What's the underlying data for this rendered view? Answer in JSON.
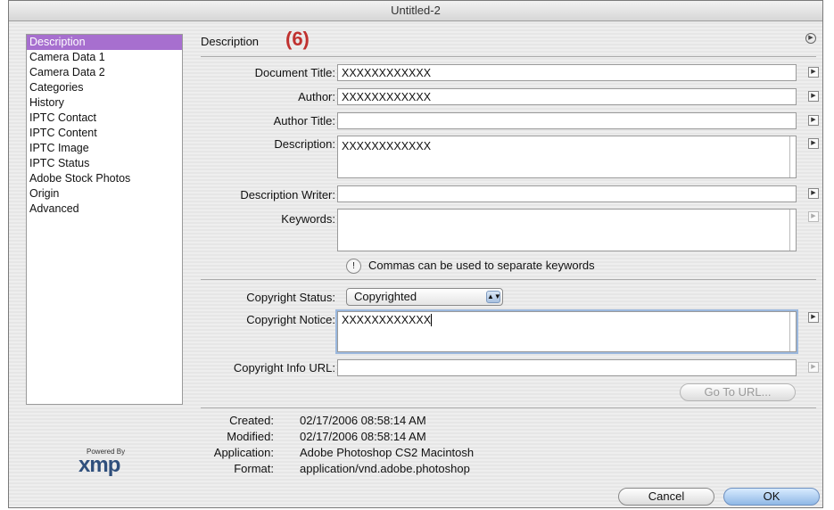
{
  "window": {
    "title": "Untitled-2"
  },
  "annotation": "(6)",
  "sidebar": {
    "items": [
      {
        "label": "Description",
        "selected": true
      },
      {
        "label": "Camera Data 1"
      },
      {
        "label": "Camera Data 2"
      },
      {
        "label": "Categories"
      },
      {
        "label": "History"
      },
      {
        "label": "IPTC Contact"
      },
      {
        "label": "IPTC Content"
      },
      {
        "label": "IPTC Image"
      },
      {
        "label": "IPTC Status"
      },
      {
        "label": "Adobe Stock Photos"
      },
      {
        "label": "Origin"
      },
      {
        "label": "Advanced"
      }
    ]
  },
  "panel": {
    "title": "Description"
  },
  "fields": {
    "document_title": {
      "label": "Document Title:",
      "value": "XXXXXXXXXXXX"
    },
    "author": {
      "label": "Author:",
      "value": "XXXXXXXXXXXX"
    },
    "author_title": {
      "label": "Author Title:",
      "value": ""
    },
    "description": {
      "label": "Description:",
      "value": "XXXXXXXXXXXX"
    },
    "description_writer": {
      "label": "Description Writer:",
      "value": ""
    },
    "keywords": {
      "label": "Keywords:",
      "value": ""
    },
    "keywords_hint": "Commas can be used to separate keywords",
    "copyright_status": {
      "label": "Copyright Status:",
      "value": "Copyrighted"
    },
    "copyright_notice": {
      "label": "Copyright Notice:",
      "value": "XXXXXXXXXXXX"
    },
    "copyright_info_url": {
      "label": "Copyright Info URL:",
      "value": ""
    }
  },
  "buttons": {
    "goto_url": "Go To URL...",
    "cancel": "Cancel",
    "ok": "OK"
  },
  "metadata": {
    "created": {
      "label": "Created:",
      "value": "02/17/2006 08:58:14 AM"
    },
    "modified": {
      "label": "Modified:",
      "value": "02/17/2006 08:58:14 AM"
    },
    "application": {
      "label": "Application:",
      "value": "Adobe Photoshop CS2 Macintosh"
    },
    "format": {
      "label": "Format:",
      "value": "application/vnd.adobe.photoshop"
    }
  },
  "branding": {
    "caption": "Powered By",
    "logo": "xmp"
  },
  "icons": {
    "menu": "flyout-menu-icon",
    "field_menu": "field-popup-arrow-icon",
    "hint": "info-icon",
    "select": "select-arrows-icon"
  }
}
